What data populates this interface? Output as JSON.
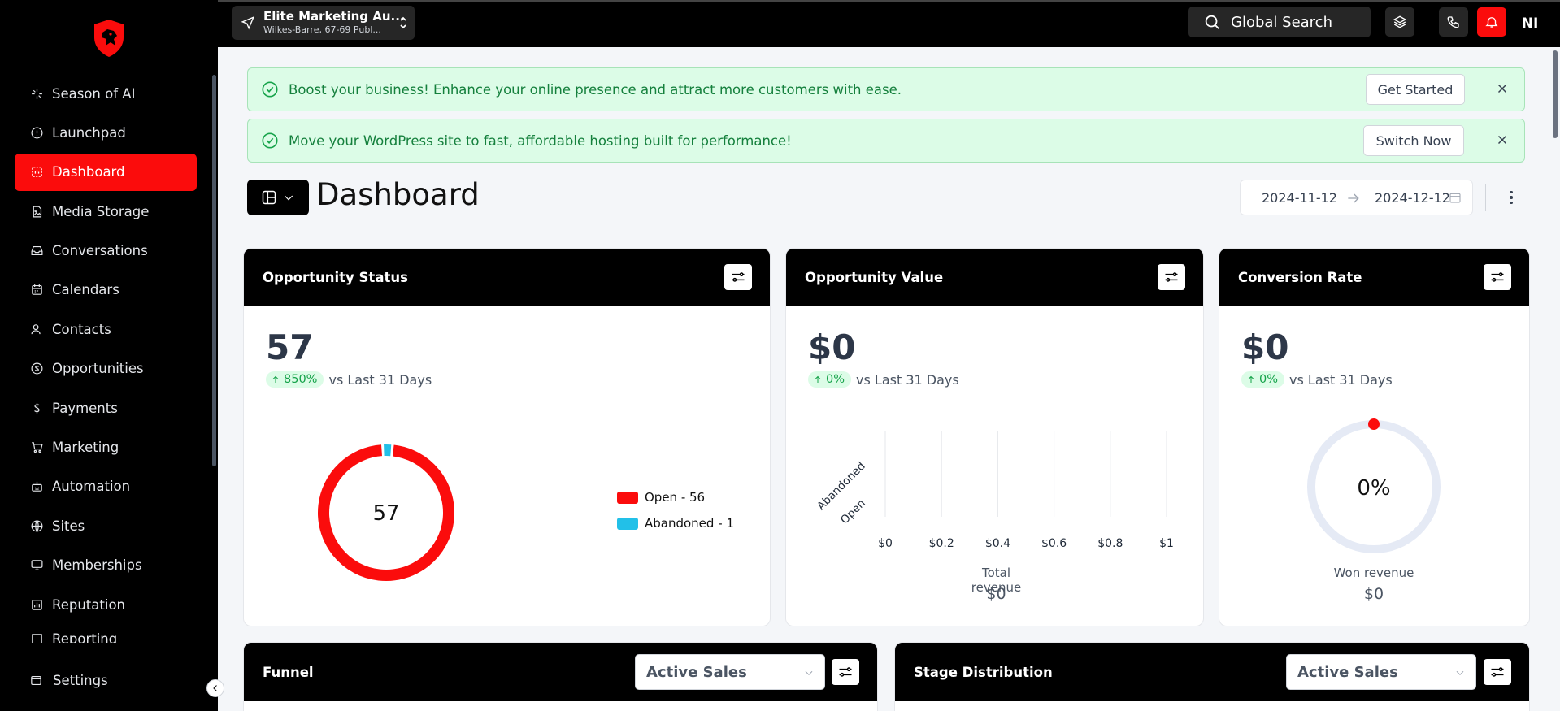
{
  "sidebar": {
    "items": [
      {
        "label": "Season of AI",
        "icon": "sparkle-icon"
      },
      {
        "label": "Launchpad",
        "icon": "info-circle-icon"
      },
      {
        "label": "Dashboard",
        "icon": "dashboard-icon"
      },
      {
        "label": "Media Storage",
        "icon": "file-image-icon"
      },
      {
        "label": "Conversations",
        "icon": "inbox-icon"
      },
      {
        "label": "Calendars",
        "icon": "calendar-icon"
      },
      {
        "label": "Contacts",
        "icon": "user-icon"
      },
      {
        "label": "Opportunities",
        "icon": "dollar-circle-icon"
      },
      {
        "label": "Payments",
        "icon": "dollar-icon"
      },
      {
        "label": "Marketing",
        "icon": "cart-icon"
      },
      {
        "label": "Automation",
        "icon": "robot-icon"
      },
      {
        "label": "Sites",
        "icon": "globe-icon"
      },
      {
        "label": "Memberships",
        "icon": "monitor-icon"
      },
      {
        "label": "Reputation",
        "icon": "chart-box-icon"
      },
      {
        "label": "Reporting",
        "icon": "report-icon"
      }
    ],
    "active": "Dashboard",
    "settings_label": "Settings"
  },
  "topbar": {
    "location_name": "Elite Marketing Au...",
    "location_address": "Wilkes-Barre, 67-69 Publ...",
    "search_label": "Global Search",
    "avatar_initials": "NI"
  },
  "banners": [
    {
      "message": "Boost your business! Enhance your online presence and attract more customers with ease.",
      "cta": "Get Started"
    },
    {
      "message": "Move your WordPress site to fast, affordable hosting built for performance!",
      "cta": "Switch Now"
    }
  ],
  "dashboard": {
    "title": "Dashboard",
    "start_date": "2024-11-12",
    "end_date": "2024-12-12"
  },
  "cards": {
    "opportunity_status": {
      "title": "Opportunity Status",
      "value": "57",
      "delta": "850%",
      "compare": "vs Last 31 Days",
      "donut_center": "57",
      "legend": [
        {
          "label": "Open - 56",
          "color": "#fb0c0c",
          "count": 56
        },
        {
          "label": "Abandoned - 1",
          "color": "#22c0e8",
          "count": 1
        }
      ]
    },
    "opportunity_value": {
      "title": "Opportunity Value",
      "value": "$0",
      "delta": "0%",
      "compare": "vs Last 31 Days",
      "total_label": "Total revenue",
      "total_value": "$0"
    },
    "conversion_rate": {
      "title": "Conversion Rate",
      "value": "$0",
      "delta": "0%",
      "compare": "vs Last 31 Days",
      "gauge_value": "0%",
      "won_label": "Won revenue",
      "won_value": "$0"
    },
    "funnel": {
      "title": "Funnel",
      "select_value": "Active Sales"
    },
    "stage_distribution": {
      "title": "Stage Distribution",
      "select_value": "Active Sales"
    }
  },
  "chart_data": [
    {
      "type": "pie",
      "categories": [
        "Open",
        "Abandoned"
      ],
      "values": [
        56,
        1
      ],
      "title": "Opportunity Status"
    },
    {
      "type": "bar",
      "orientation": "horizontal",
      "categories": [
        "Abandoned",
        "Open"
      ],
      "values": [
        0,
        0
      ],
      "x_ticks": [
        "$0",
        "$0.2",
        "$0.4",
        "$0.6",
        "$0.8",
        "$1"
      ],
      "xlim": [
        0,
        1
      ],
      "title": "Opportunity Value"
    }
  ],
  "colors": {
    "accent": "#fb0c0c",
    "success": "#16a34a",
    "banner_bg": "#dcfce7",
    "gauge_track": "#e5eaf5"
  }
}
